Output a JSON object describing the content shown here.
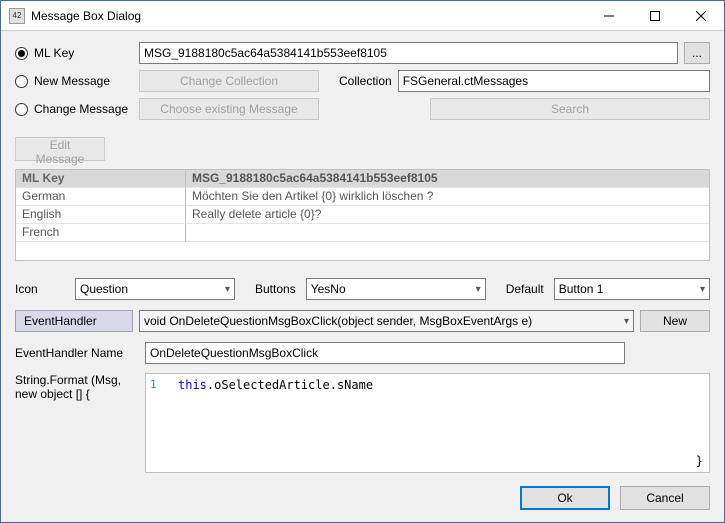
{
  "window": {
    "title": "Message Box Dialog",
    "icon_text": "42"
  },
  "radios": {
    "ml_key": "ML Key",
    "new_message": "New Message",
    "change_message": "Change Message",
    "selected": "ml_key"
  },
  "ml_key_value": "MSG_9188180c5ac64a5384141b553eef8105",
  "browse_button": "...",
  "buttons": {
    "change_collection": "Change Collection",
    "choose_existing": "Choose existing Message",
    "search": "Search",
    "edit_message": "Edit Message",
    "new": "New",
    "ok": "Ok",
    "cancel": "Cancel"
  },
  "collection": {
    "label": "Collection",
    "value": "FSGeneral.ctMessages"
  },
  "grid": {
    "header_left": "ML Key",
    "header_right": "MSG_9188180c5ac64a5384141b553eef8105",
    "rows": [
      {
        "lang": "German",
        "text": "Möchten Sie den Artikel {0} wirklich löschen ?"
      },
      {
        "lang": "English",
        "text": "Really delete article {0}?"
      },
      {
        "lang": "French",
        "text": ""
      }
    ]
  },
  "icon_select": {
    "label": "Icon",
    "value": "Question"
  },
  "buttons_select": {
    "label": "Buttons",
    "value": "YesNo"
  },
  "default_select": {
    "label": "Default",
    "value": "Button 1"
  },
  "eventhandler": {
    "label": "EventHandler",
    "value": "void OnDeleteQuestionMsgBoxClick(object sender, MsgBoxEventArgs e)"
  },
  "eventhandler_name": {
    "label": "EventHandler Name",
    "value": "OnDeleteQuestionMsgBoxClick"
  },
  "stringformat": {
    "label": "String.Format (Msg, new object [] {",
    "code_keyword": "this",
    "code_rest": ".oSelectedArticle.sName",
    "line_number": "1",
    "close": "}"
  }
}
